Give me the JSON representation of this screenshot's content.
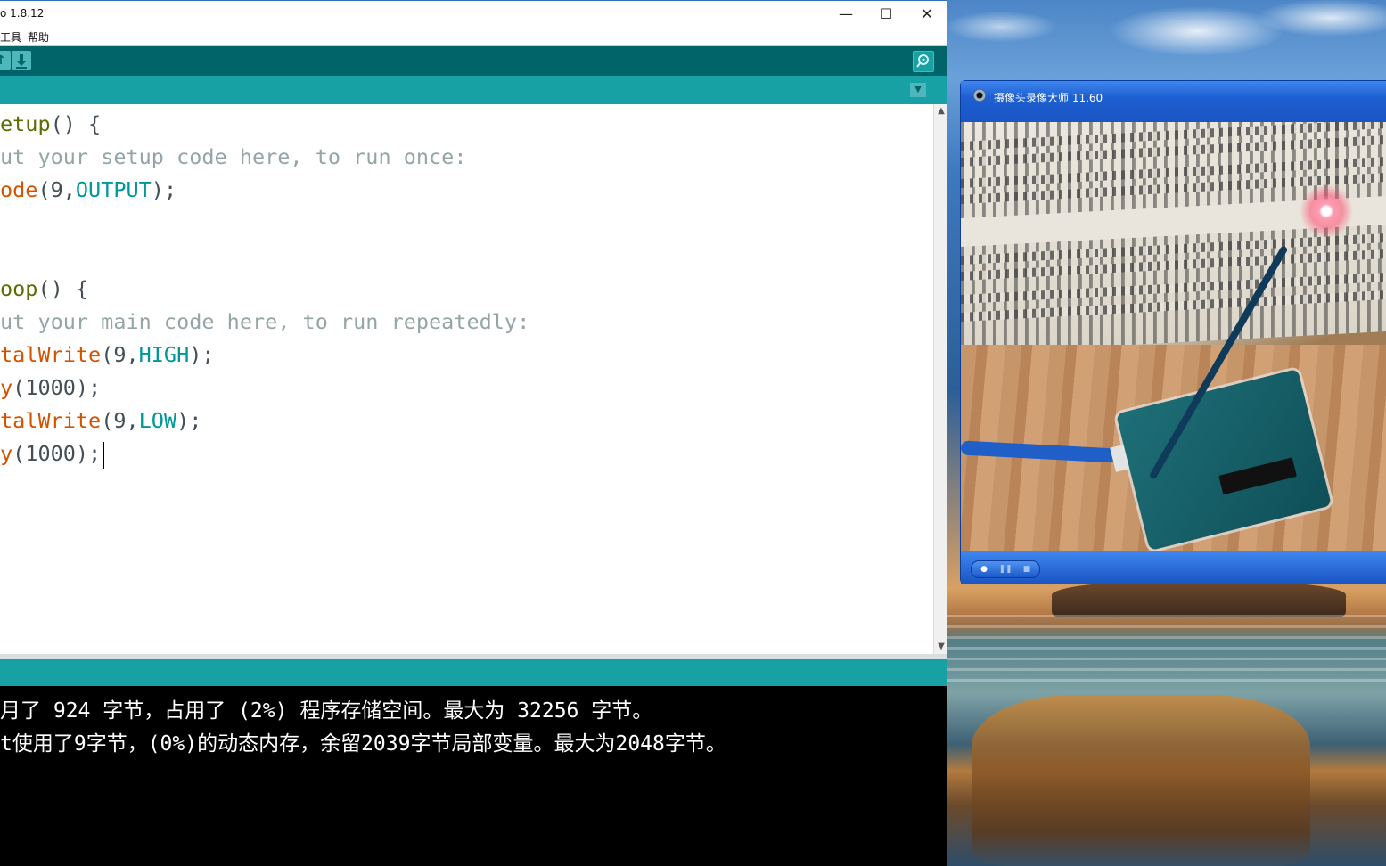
{
  "ide": {
    "title": "o 1.8.12",
    "window_controls": {
      "minimize": "—",
      "maximize": "☐",
      "close": "✕"
    },
    "menu": {
      "tools": "工具",
      "help": "帮助"
    },
    "toolbar": {
      "open_icon": "open-icon",
      "save_icon": "save-icon",
      "serial_monitor_icon": "serial-monitor-icon"
    },
    "tab_menu_icon": "▼",
    "code_lines": [
      [
        {
          "t": "etup",
          "c": "olive"
        },
        {
          "t": "() {",
          "c": "plain"
        }
      ],
      [
        {
          "t": "ut your setup code here, to run once:",
          "c": "cmt"
        }
      ],
      [
        {
          "t": "ode",
          "c": "fn"
        },
        {
          "t": "(9,",
          "c": "plain"
        },
        {
          "t": "OUTPUT",
          "c": "blue"
        },
        {
          "t": ");",
          "c": "plain"
        }
      ],
      [],
      [],
      [
        {
          "t": "oop",
          "c": "olive"
        },
        {
          "t": "() {",
          "c": "plain"
        }
      ],
      [
        {
          "t": "ut your main code here, to run repeatedly:",
          "c": "cmt"
        }
      ],
      [
        {
          "t": "talWrite",
          "c": "fn"
        },
        {
          "t": "(9,",
          "c": "plain"
        },
        {
          "t": "HIGH",
          "c": "blue"
        },
        {
          "t": ");",
          "c": "plain"
        }
      ],
      [
        {
          "t": "y",
          "c": "fn"
        },
        {
          "t": "(1000);",
          "c": "plain"
        }
      ],
      [
        {
          "t": "talWrite",
          "c": "fn"
        },
        {
          "t": "(9,",
          "c": "plain"
        },
        {
          "t": "LOW",
          "c": "blue"
        },
        {
          "t": ");",
          "c": "plain"
        }
      ],
      [
        {
          "t": "y",
          "c": "fn"
        },
        {
          "t": "(1000);",
          "c": "plain"
        },
        {
          "t": "",
          "c": "cursor"
        }
      ]
    ],
    "console": {
      "line1": "月了 924 字节，占用了 (2%) 程序存储空间。最大为 32256 字节。",
      "line2": "t使用了9字节，(0%)的动态内存，余留2039字节局部变量。最大为2048字节。"
    },
    "colors": {
      "toolbar": "#006468",
      "tabbar": "#17a1a5",
      "fn": "#d35400",
      "keyword": "#00979c",
      "comment": "#95a5a6"
    }
  },
  "cam_window": {
    "title": "摄像头录像大师 11.60",
    "controls": {
      "record": "●",
      "pause": "❚❚",
      "stop": "■"
    }
  }
}
